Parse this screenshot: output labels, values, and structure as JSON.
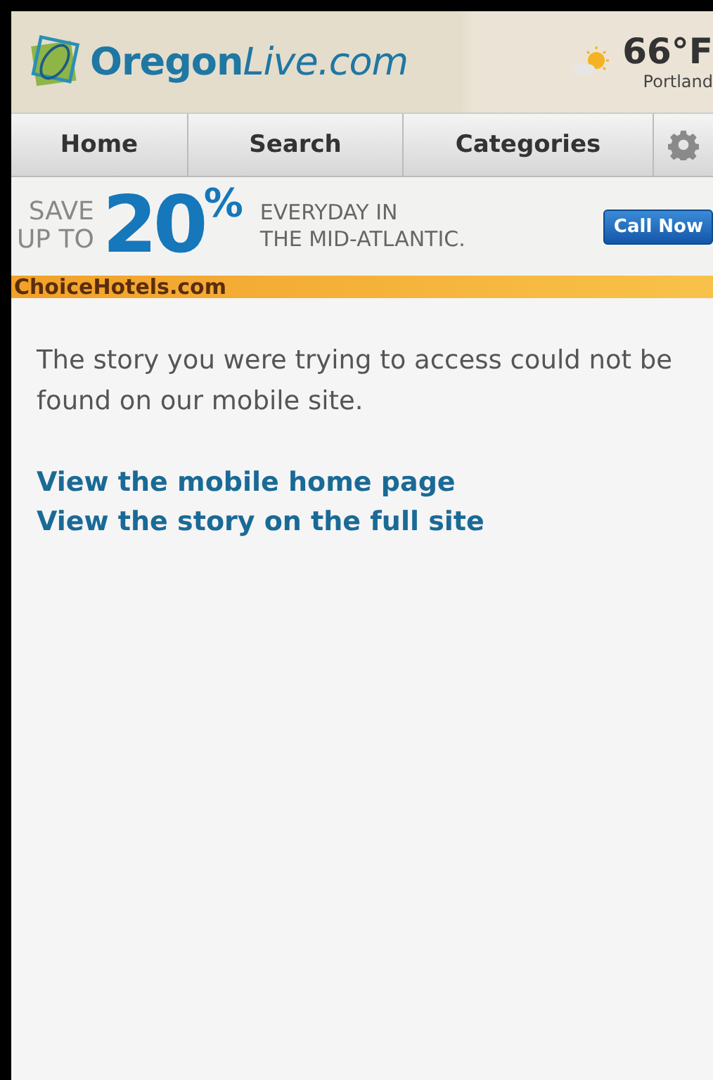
{
  "header": {
    "logo_bold": "Oregon",
    "logo_italic": "Live.com",
    "temperature": "66°F",
    "city": "Portland"
  },
  "nav": {
    "tabs": [
      {
        "label": "Home"
      },
      {
        "label": "Search"
      },
      {
        "label": "Categories"
      }
    ]
  },
  "ad": {
    "save": "SAVE",
    "up_to": "UP TO",
    "amount": "20",
    "percent": "%",
    "line_1": "EVERYDAY IN",
    "line_2": "THE MID-ATLANTIC.",
    "button": "Call Now",
    "sponsor": "ChoiceHotels.com"
  },
  "message": "The story you were trying to access could not be found on our mobile site.",
  "links": [
    "View the mobile home page",
    "View the story on the full site"
  ]
}
